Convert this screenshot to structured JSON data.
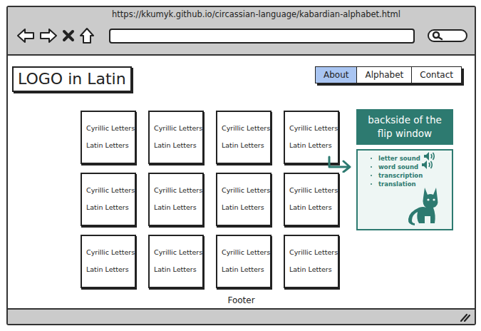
{
  "browser": {
    "url": "https://kkumyk.github.io/circassian-language/kabardian-alphabet.html"
  },
  "logo": "LOGO in Latin",
  "nav": [
    {
      "label": "About",
      "selected": true
    },
    {
      "label": "Alphabet",
      "selected": false
    },
    {
      "label": "Contact",
      "selected": false
    }
  ],
  "cards": [
    {
      "cyrillic": "Cyrillic Letters",
      "latin": "Latin Letters"
    },
    {
      "cyrillic": "Cyrillic Letters",
      "latin": "Latin Letters"
    },
    {
      "cyrillic": "Cyrillic Letters",
      "latin": "Latin Letters"
    },
    {
      "cyrillic": "Cyrillic Letters",
      "latin": "Latin Letters"
    },
    {
      "cyrillic": "Cyrillic Letters",
      "latin": "Latin Letters"
    },
    {
      "cyrillic": "Cyrillic Letters",
      "latin": "Latin Letters"
    },
    {
      "cyrillic": "Cyrillic Letters",
      "latin": "Latin Letters"
    },
    {
      "cyrillic": "Cyrillic Letters",
      "latin": "Latin Letters"
    },
    {
      "cyrillic": "Cyrillic Letters",
      "latin": "Latin Letters"
    },
    {
      "cyrillic": "Cyrillic Letters",
      "latin": "Latin Letters"
    },
    {
      "cyrillic": "Cyrillic Letters",
      "latin": "Latin Letters"
    },
    {
      "cyrillic": "Cyrillic Letters",
      "latin": "Latin Letters"
    }
  ],
  "flip_panel": {
    "title": "backside of the flip window",
    "items": [
      {
        "label": "letter sound",
        "kind": "sound"
      },
      {
        "label": "word sound",
        "kind": "sound"
      },
      {
        "label": "transcription",
        "kind": "text"
      },
      {
        "label": "translation",
        "kind": "text"
      }
    ]
  },
  "footer": "Footer"
}
